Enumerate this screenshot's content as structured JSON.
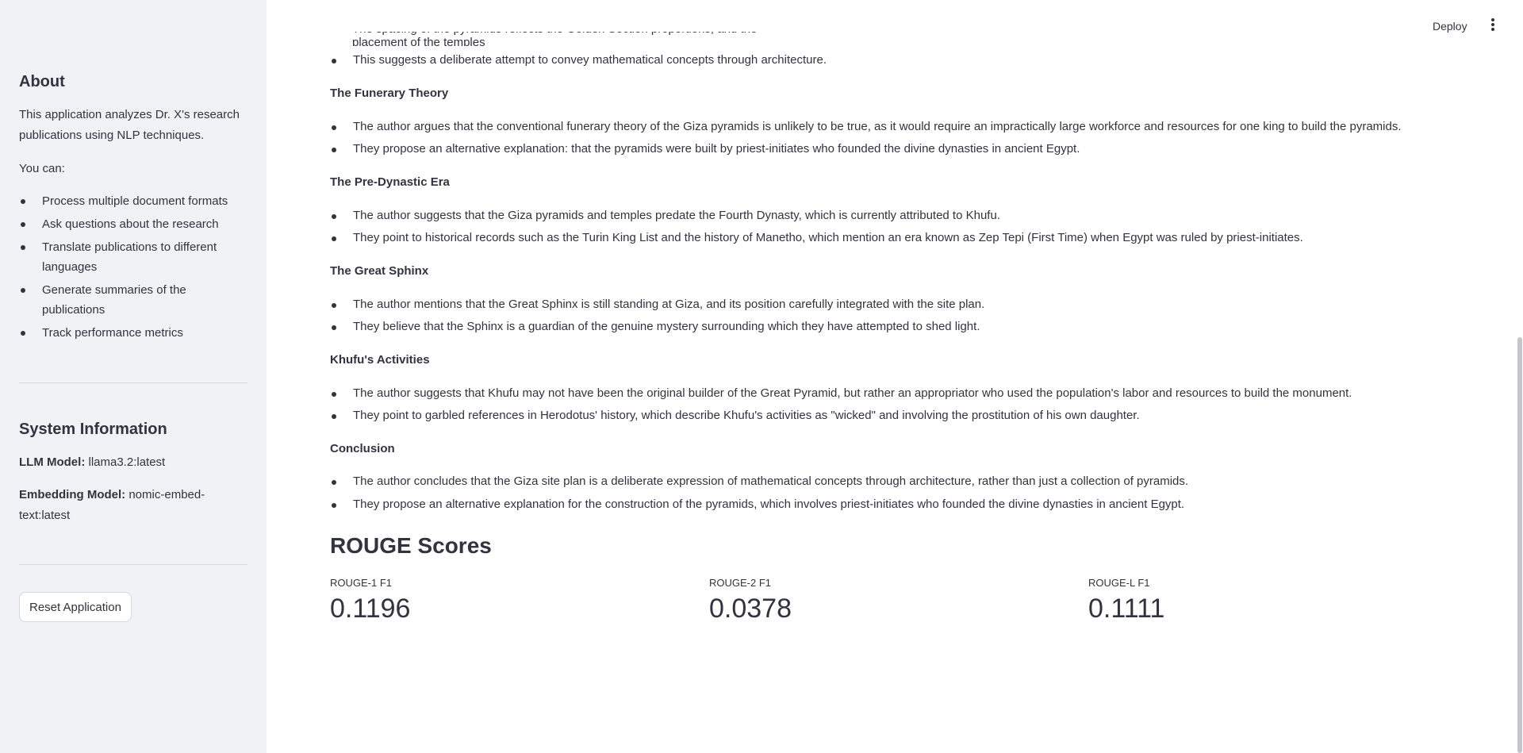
{
  "sidebar": {
    "about_title": "About",
    "about_desc": "This application analyzes Dr. X's research publications using NLP techniques.",
    "you_can": "You can:",
    "capabilities": [
      "Process multiple document formats",
      "Ask questions about the research",
      "Translate publications to different languages",
      "Generate summaries of the publications",
      "Track performance metrics"
    ],
    "system_title": "System Information",
    "llm_label": "LLM Model:",
    "llm_value": "llama3.2:latest",
    "embedding_label": "Embedding Model:",
    "embedding_value": "nomic-embed-text:latest",
    "reset_label": "Reset Application"
  },
  "header": {
    "deploy_label": "Deploy",
    "menu_icon": "kebab-menu-icon"
  },
  "summary": {
    "partial_line": "The spacing of the pyramids reflects the Golden Section proportions, and the placement of the temples",
    "intro_bullet": "This suggests a deliberate attempt to convey mathematical concepts through architecture.",
    "sections": [
      {
        "title": "The Funerary Theory",
        "bullets": [
          "The author argues that the conventional funerary theory of the Giza pyramids is unlikely to be true, as it would require an impractically large workforce and resources for one king to build the pyramids.",
          "They propose an alternative explanation: that the pyramids were built by priest-initiates who founded the divine dynasties in ancient Egypt."
        ]
      },
      {
        "title": "The Pre-Dynastic Era",
        "bullets": [
          "The author suggests that the Giza pyramids and temples predate the Fourth Dynasty, which is currently attributed to Khufu.",
          "They point to historical records such as the Turin King List and the history of Manetho, which mention an era known as Zep Tepi (First Time) when Egypt was ruled by priest-initiates."
        ]
      },
      {
        "title": "The Great Sphinx",
        "bullets": [
          "The author mentions that the Great Sphinx is still standing at Giza, and its position carefully integrated with the site plan.",
          "They believe that the Sphinx is a guardian of the genuine mystery surrounding which they have attempted to shed light."
        ]
      },
      {
        "title": "Khufu's Activities",
        "bullets": [
          "The author suggests that Khufu may not have been the original builder of the Great Pyramid, but rather an appropriator who used the population's labor and resources to build the monument.",
          "They point to garbled references in Herodotus' history, which describe Khufu's activities as \"wicked\" and involving the prostitution of his own daughter."
        ]
      },
      {
        "title": "Conclusion",
        "bullets": [
          "The author concludes that the Giza site plan is a deliberate expression of mathematical concepts through architecture, rather than just a collection of pyramids.",
          "They propose an alternative explanation for the construction of the pyramids, which involves priest-initiates who founded the divine dynasties in ancient Egypt."
        ]
      }
    ]
  },
  "rouge": {
    "heading": "ROUGE Scores",
    "metrics": [
      {
        "label": "ROUGE-1 F1",
        "value": "0.1196"
      },
      {
        "label": "ROUGE-2 F1",
        "value": "0.0378"
      },
      {
        "label": "ROUGE-L F1",
        "value": "0.1111"
      }
    ]
  },
  "colors": {
    "sidebar_bg": "#f0f2f6",
    "text": "#31333f",
    "divider": "#d5d7de"
  }
}
